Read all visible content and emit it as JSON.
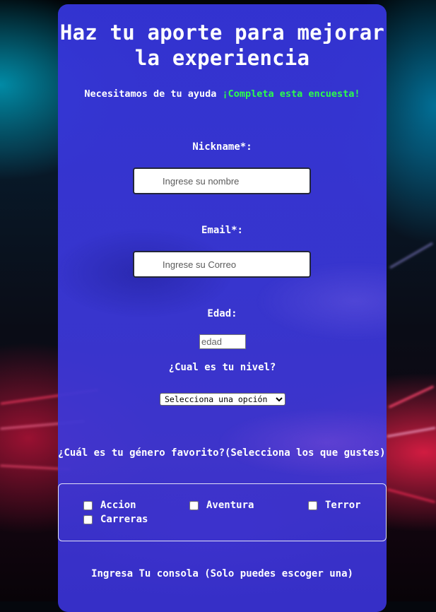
{
  "header": {
    "title_line1": "Haz tu aporte para mejorar",
    "title_line2": "la experiencia",
    "subtitle_text": "Necesitamos de tu ayuda ",
    "subtitle_highlight": "¡Completa esta encuesta!",
    "highlight_color": "#2cff4a"
  },
  "form": {
    "nickname_label": "Nickname*:",
    "nickname_placeholder": "Ingrese su nombre",
    "email_label": "Email*:",
    "email_placeholder": "Ingrese su Correo",
    "age_label": "Edad:",
    "age_placeholder": "edad",
    "level_label": "¿Cual es tu nivel?",
    "level_selected": "Selecciona una opción",
    "genre_question": "¿Cuál es tu género favorito?(Selecciona los que gustes)",
    "genres": [
      "Accion",
      "Aventura",
      "Terror",
      "Carreras"
    ],
    "console_label": "Ingresa Tu consola (Solo puedes escoger una)"
  },
  "colors": {
    "card": "#3434d6",
    "text": "#ffffff"
  }
}
